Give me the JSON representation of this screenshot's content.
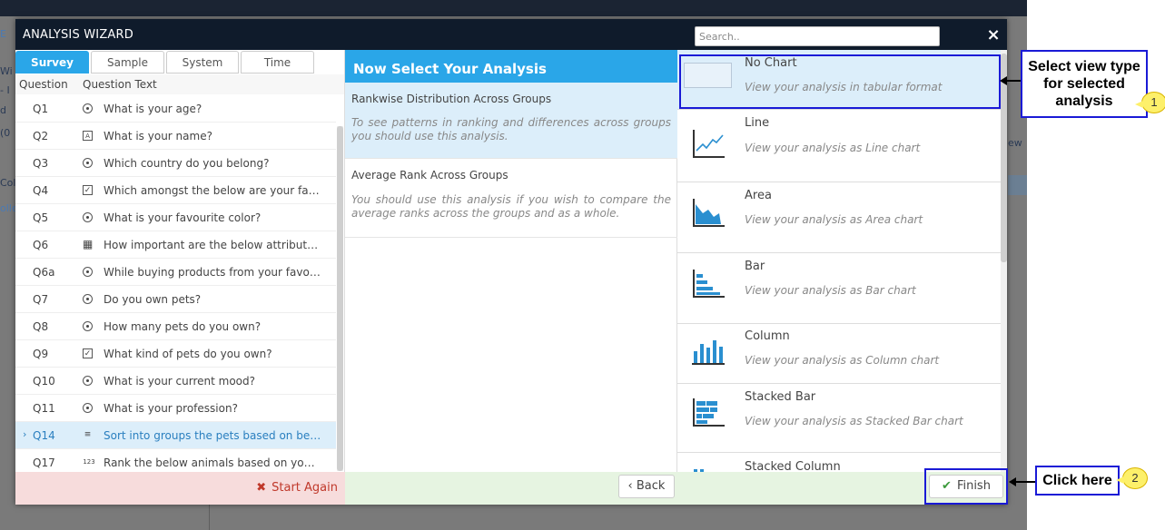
{
  "background_fragments": [
    "E",
    "- I",
    "Wi",
    "d",
    "(0",
    "Coll",
    "olle",
    "ew"
  ],
  "modal": {
    "title": "ANALYSIS WIZARD",
    "search_placeholder": "Search..",
    "close_icon": "×"
  },
  "tabs": [
    {
      "label": "Survey",
      "active": true
    },
    {
      "label": "Sample",
      "active": false
    },
    {
      "label": "System",
      "active": false
    },
    {
      "label": "Time",
      "active": false
    }
  ],
  "question_table": {
    "headers": {
      "question": "Question",
      "text": "Question Text"
    },
    "rows": [
      {
        "id": "Q1",
        "icon": "radio-icon",
        "text": "What is your age?"
      },
      {
        "id": "Q2",
        "icon": "text-icon",
        "text": "What is your name?"
      },
      {
        "id": "Q3",
        "icon": "radio-icon",
        "text": "Which country do you belong?"
      },
      {
        "id": "Q4",
        "icon": "checkbox-icon",
        "text": "Which amongst the below are your fav..."
      },
      {
        "id": "Q5",
        "icon": "radio-icon",
        "text": "What is your favourite color?"
      },
      {
        "id": "Q6",
        "icon": "grid-icon",
        "text": "How important are the below attributes..."
      },
      {
        "id": "Q6a",
        "icon": "radio-icon",
        "text": "While buying products from your favou..."
      },
      {
        "id": "Q7",
        "icon": "radio-icon",
        "text": "Do you own pets?"
      },
      {
        "id": "Q8",
        "icon": "radio-icon",
        "text": "How many pets do you own?"
      },
      {
        "id": "Q9",
        "icon": "checkbox-icon",
        "text": "What kind of pets do you own?"
      },
      {
        "id": "Q10",
        "icon": "radio-icon",
        "text": "What is your current mood?"
      },
      {
        "id": "Q11",
        "icon": "radio-icon",
        "text": "What is your profession?"
      },
      {
        "id": "Q14",
        "icon": "sort-icon",
        "text": "Sort into groups the pets based on belo...",
        "selected": true
      },
      {
        "id": "Q17",
        "icon": "rank-icon",
        "text": "Rank the below animals based on your ..."
      }
    ]
  },
  "analysis": {
    "header": "Now Select Your Analysis",
    "items": [
      {
        "title": "Rankwise Distribution Across Groups",
        "desc": "To see patterns in ranking and differences across groups you should use this analysis.",
        "selected": true
      },
      {
        "title": "Average Rank Across Groups",
        "desc": "You should use this analysis if you wish to compare the average ranks across the groups and as a whole.",
        "selected": false
      }
    ]
  },
  "charts": [
    {
      "name": "No Chart",
      "desc": "View your analysis in tabular format",
      "icon": "no-chart-icon",
      "selected": true
    },
    {
      "name": "Line",
      "desc": "View your analysis as Line chart",
      "icon": "line-chart-icon"
    },
    {
      "name": "Area",
      "desc": "View your analysis as Area chart",
      "icon": "area-chart-icon"
    },
    {
      "name": "Bar",
      "desc": "View your analysis as Bar chart",
      "icon": "bar-chart-icon"
    },
    {
      "name": "Column",
      "desc": "View your analysis as Column chart",
      "icon": "column-chart-icon"
    },
    {
      "name": "Stacked Bar",
      "desc": "View your analysis as Stacked Bar chart",
      "icon": "stacked-bar-chart-icon"
    },
    {
      "name": "Stacked Column",
      "desc": "",
      "icon": "stacked-column-chart-icon"
    }
  ],
  "footer": {
    "start_again": "Start Again",
    "back": "Back",
    "finish": "Finish"
  },
  "annotations": {
    "callout1": "Select view type for selected analysis",
    "badge1": "1",
    "callout2": "Click here",
    "badge2": "2"
  },
  "colors": {
    "accent": "#2aa6e8",
    "header_bg": "#0f1b2b",
    "selected_bg": "#dceefa",
    "highlight_border": "#1a1ad6",
    "badge": "#fdf06a"
  }
}
